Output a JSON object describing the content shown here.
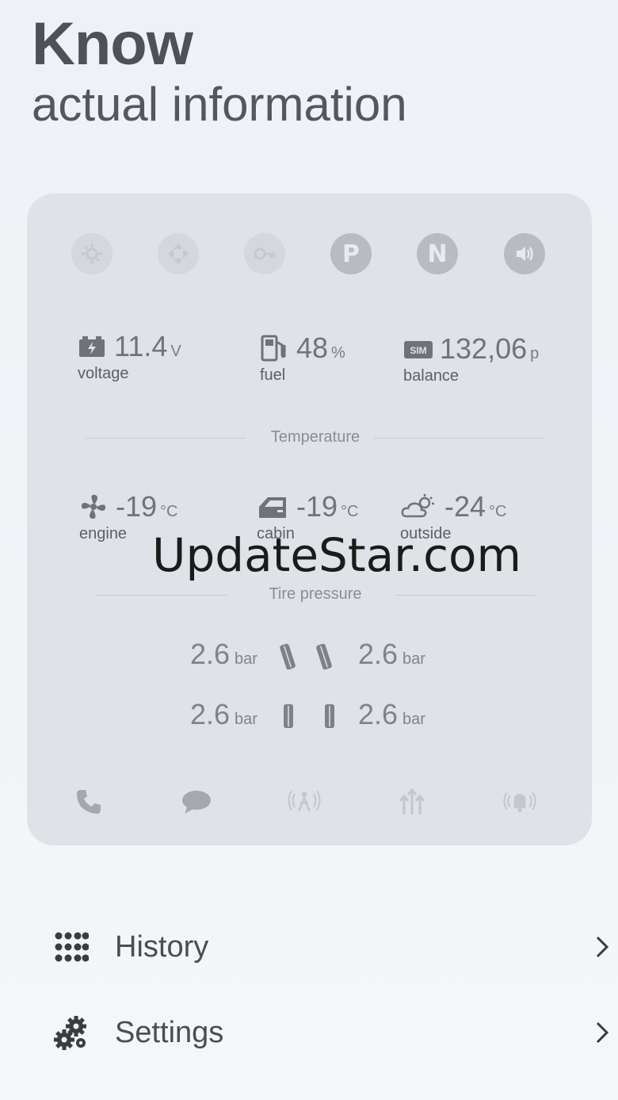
{
  "header": {
    "title": "Know",
    "subtitle": "actual information"
  },
  "status_icons": [
    {
      "icon": "ignition-icon",
      "active": false
    },
    {
      "icon": "arrows-icon",
      "active": false
    },
    {
      "icon": "key-icon",
      "active": false
    },
    {
      "icon": "parking-icon",
      "active": true,
      "letter": "P"
    },
    {
      "icon": "neutral-icon",
      "active": true,
      "letter": "N"
    },
    {
      "icon": "speaker-icon",
      "active": true
    }
  ],
  "metrics": {
    "voltage": {
      "value": "11.4",
      "unit": "V",
      "label": "voltage"
    },
    "fuel": {
      "value": "48",
      "unit": "%",
      "label": "fuel"
    },
    "balance": {
      "value": "132,06",
      "unit": "p",
      "label": "balance"
    }
  },
  "temperature": {
    "section_title": "Temperature",
    "engine": {
      "value": "-19",
      "unit": "°C",
      "label": "engine"
    },
    "cabin": {
      "value": "-19",
      "unit": "°C",
      "label": "cabin"
    },
    "outside": {
      "value": "-24",
      "unit": "°C",
      "label": "outside"
    }
  },
  "tire_pressure": {
    "section_title": "Tire pressure",
    "front_left": {
      "value": "2.6",
      "unit": "bar"
    },
    "front_right": {
      "value": "2.6",
      "unit": "bar"
    },
    "rear_left": {
      "value": "2.6",
      "unit": "bar"
    },
    "rear_right": {
      "value": "2.6",
      "unit": "bar"
    }
  },
  "bottom_icons": [
    "phone-icon",
    "message-icon",
    "alarm-icon",
    "arrows-up-icon",
    "siren-icon"
  ],
  "watermark": "UpdateStar.com",
  "menu": [
    {
      "label": "History",
      "icon": "grid-icon"
    },
    {
      "label": "Settings",
      "icon": "gears-icon"
    }
  ],
  "colors": {
    "card": "#dfe2e6",
    "accent_icon": "#b8bcc2",
    "text": "#4a4d52"
  }
}
